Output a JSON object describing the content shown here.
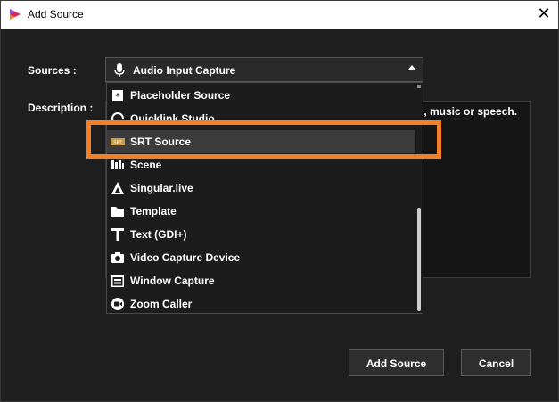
{
  "window": {
    "title": "Add Source",
    "close_glyph": "✕"
  },
  "form": {
    "sources_label": "Sources :",
    "description_label": "Description :",
    "description_text": "d, music or speech."
  },
  "combo": {
    "icon": "microphone-icon",
    "selected": "Audio Input Capture"
  },
  "dropdown": {
    "items": [
      {
        "label": "Placeholder Source",
        "icon": "asterisk-icon"
      },
      {
        "label": "Quicklink Studio",
        "icon": "quicklink-icon"
      },
      {
        "label": "SRT Source",
        "icon": "srt-icon",
        "selected": true
      },
      {
        "label": "Scene",
        "icon": "scene-icon"
      },
      {
        "label": "Singular.live",
        "icon": "singular-icon"
      },
      {
        "label": "Template",
        "icon": "folder-icon"
      },
      {
        "label": "Text (GDI+)",
        "icon": "text-icon"
      },
      {
        "label": "Video Capture Device",
        "icon": "camera-icon"
      },
      {
        "label": "Window Capture",
        "icon": "window-icon"
      },
      {
        "label": "Zoom Caller",
        "icon": "zoom-icon"
      }
    ]
  },
  "buttons": {
    "add": "Add Source",
    "cancel": "Cancel"
  },
  "colors": {
    "highlight": "#f47f24",
    "background": "#1e1e1e"
  }
}
